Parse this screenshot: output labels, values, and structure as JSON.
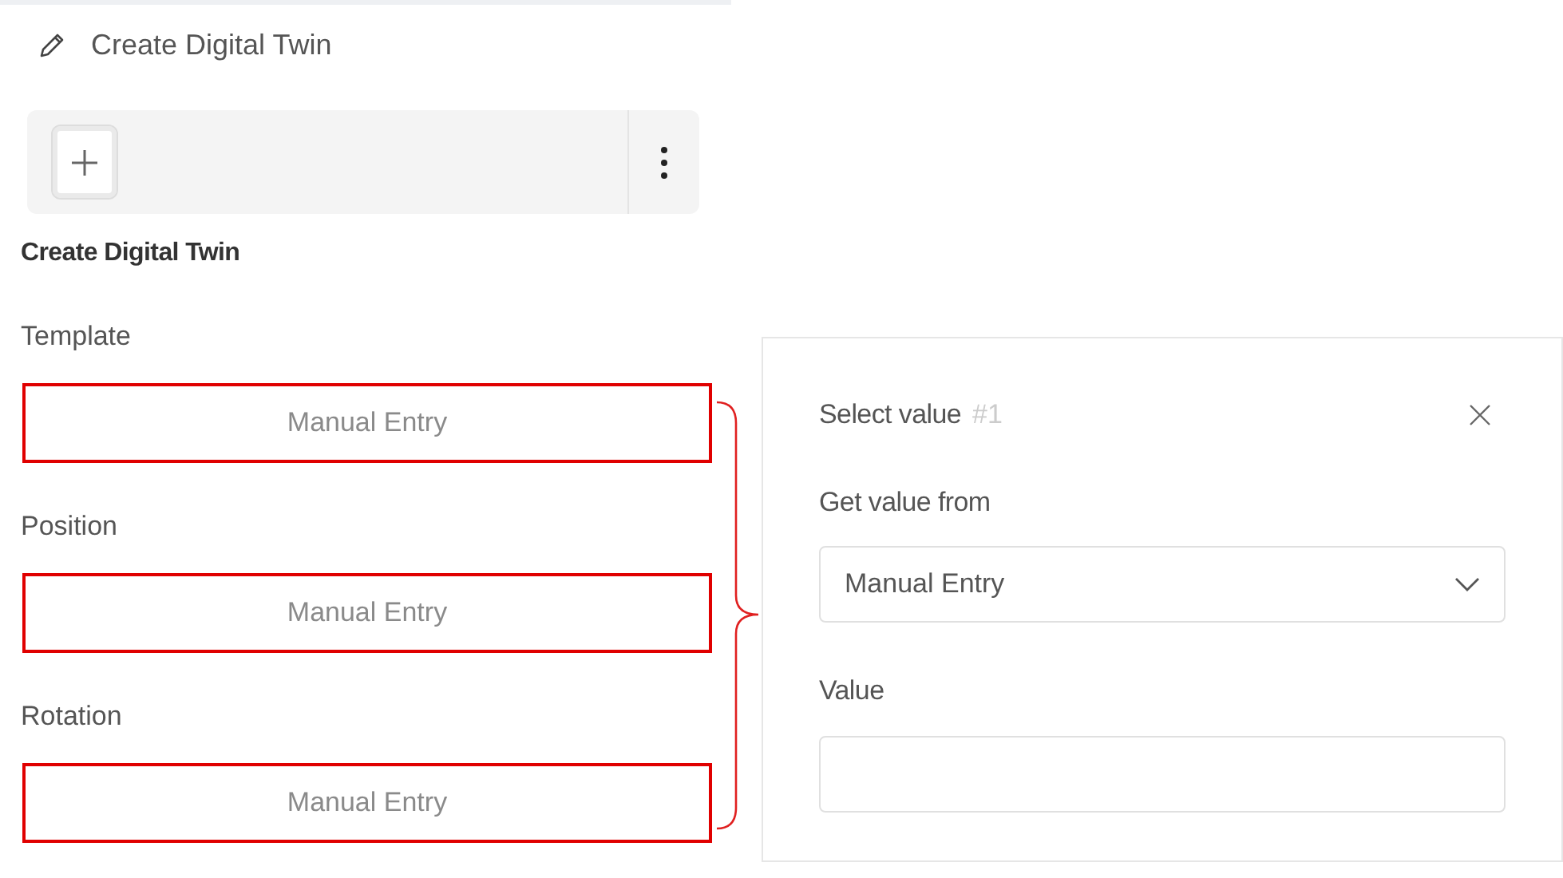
{
  "header": {
    "title": "Create Digital Twin"
  },
  "section": {
    "title": "Create Digital Twin"
  },
  "fields": [
    {
      "label": "Template",
      "value": "Manual Entry",
      "highlighted": true
    },
    {
      "label": "Position",
      "value": "Manual Entry",
      "highlighted": true
    },
    {
      "label": "Rotation",
      "value": "Manual Entry",
      "highlighted": true
    }
  ],
  "panel": {
    "title": "Select value",
    "number": "#1",
    "source_label": "Get value from",
    "source_value": "Manual Entry",
    "value_label": "Value"
  }
}
